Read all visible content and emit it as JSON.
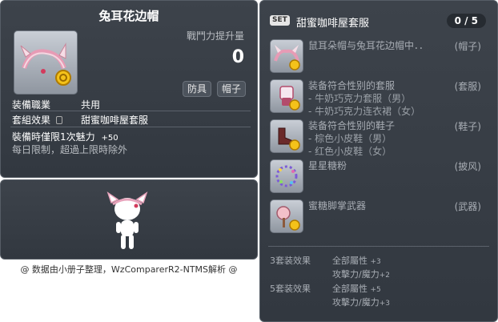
{
  "item_id": "01004882",
  "item": {
    "name": "兔耳花边帽",
    "power_label": "戰鬥力提升量",
    "power_value": "0",
    "tags": [
      "防具",
      "帽子"
    ],
    "job_label": "装備職業",
    "job_value": "共用",
    "set_label": "套組效果",
    "set_value": "甜蜜咖啡屋套服",
    "limit_label": "裝備時僅限1次魅力",
    "limit_value": "+50",
    "limit_note": "每日限制，超過上限時除外"
  },
  "credit": "@ 数据由小册子整理，WzComparerR2-NTMS解析 @",
  "set": {
    "badge": "SET",
    "title": "甜蜜咖啡屋套服",
    "count": "0 / 5",
    "items": [
      {
        "name": "鼠耳朵帽与兔耳花边帽中．．",
        "category": "(帽子)",
        "sub": [],
        "icon": "rabbit-ear-hat-icon"
      },
      {
        "name": "装备符合性别的套服",
        "category": "(套服)",
        "sub": [
          "- 牛奶巧克力套服（男）",
          "- 牛奶巧克力连衣裙（女）"
        ],
        "icon": "overall-icon"
      },
      {
        "name": "装备符合性别的鞋子",
        "category": "(鞋子)",
        "sub": [
          "- 棕色小皮鞋（男）",
          "- 红色小皮鞋（女）"
        ],
        "icon": "shoes-icon"
      },
      {
        "name": "星星糖粉",
        "category": "(披风)",
        "sub": [],
        "icon": "cape-icon"
      },
      {
        "name": "蜜糖脚掌武器",
        "category": "(武器)",
        "sub": [],
        "icon": "weapon-icon"
      }
    ],
    "effects": [
      {
        "label": "3套装效果",
        "lines": [
          {
            "text": "全部屬性",
            "val": "+3"
          },
          {
            "text": "攻擊力/魔力",
            "val": "+2"
          }
        ]
      },
      {
        "label": "5套装效果",
        "lines": [
          {
            "text": "全部屬性",
            "val": "+5"
          },
          {
            "text": "攻擊力/魔力",
            "val": "+3"
          }
        ]
      }
    ]
  }
}
